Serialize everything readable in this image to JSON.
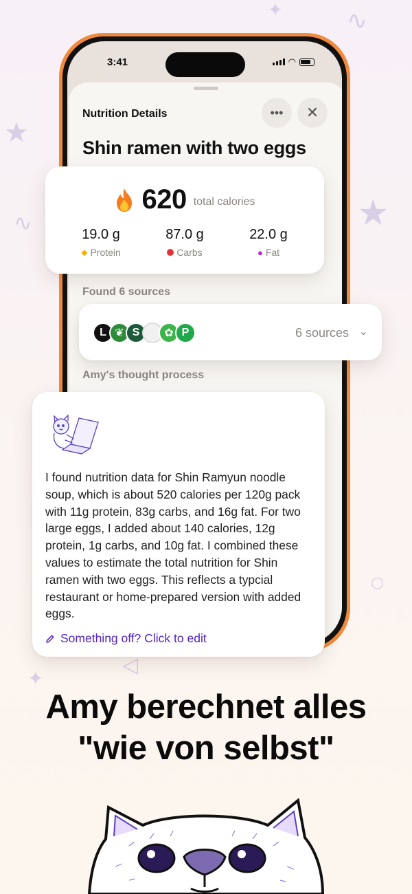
{
  "status_bar": {
    "time": "3:41"
  },
  "sheet": {
    "title": "Nutrition Details",
    "more_icon": "ellipsis-icon",
    "close_icon": "close-icon",
    "food_name": "Shin ramen with two eggs"
  },
  "calories": {
    "icon": "flame-icon",
    "value": "620",
    "label": "total calories"
  },
  "macros": [
    {
      "value": "19.0 g",
      "name": "Protein",
      "icon": "fish-icon",
      "color": "#f5b400"
    },
    {
      "value": "87.0 g",
      "name": "Carbs",
      "icon": "apple-icon",
      "color": "#e5323a"
    },
    {
      "value": "22.0 g",
      "name": "Fat",
      "icon": "drop-icon",
      "color": "#c21ec9"
    }
  ],
  "sources": {
    "section_label": "Found 6 sources",
    "count_label": "6 sources",
    "logos": [
      {
        "letter": "L",
        "color": "#111111"
      },
      {
        "letter": "",
        "color": "#2e8b3a"
      },
      {
        "letter": "S",
        "color": "#1d5a3c"
      },
      {
        "letter": "",
        "color": "#f1f1f1"
      },
      {
        "letter": "",
        "color": "#3cb44a"
      },
      {
        "letter": "P",
        "color": "#1fa94b"
      }
    ]
  },
  "thought": {
    "section_label": "Amy's thought process",
    "text": "I found nutrition data for Shin Ramyun noodle soup, which is about 520 calories per 120g pack with 11g protein, 83g carbs, and 16g fat. For two large eggs, I added about 140 calories, 12g protein, 1g carbs, and 10g fat. I combined these values to estimate the total nutrition for Shin ramen with two eggs. This reflects a typcial restaurant or home-prepared version with added eggs.",
    "edit_label": "Something off? Click to edit",
    "edit_icon": "pencil-icon"
  },
  "headline": {
    "line1": "Amy berechnet alles",
    "line2": "\"wie von selbst\""
  },
  "colors": {
    "phone_frame": "#f08a3c",
    "link": "#5324c6",
    "accent_purple": "#6a3fd8"
  }
}
